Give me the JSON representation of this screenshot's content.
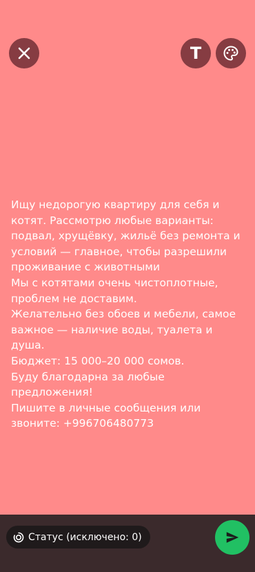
{
  "composer": {
    "background_color": "#ff8a8a",
    "close_icon": "close-icon",
    "text_tool_label": "T",
    "palette_icon": "palette-icon"
  },
  "status": {
    "lines": [
      "Ищу недорогую квартиру для себя и котят. Рассмотрю любые варианты: подвал, хрущёвку, жильё без ремонта и условий — главное, чтобы разрешили проживание с животными",
      "Мы с котятами очень чистоплотные, проблем не доставим.",
      "Желательно без обоев и мебели, самое важное — наличие воды, туалета и душа.",
      "Бюджет: 15 000–20 000 сомов.",
      "Буду благодарна за любые предложения!",
      "Пишите в личные сообщения или звоните: +996706480773"
    ]
  },
  "footer": {
    "audience_label": "Статус (исключено: 0)",
    "audience_icon": "status-ring-icon",
    "send_icon": "send-icon",
    "send_color": "#21c063"
  }
}
